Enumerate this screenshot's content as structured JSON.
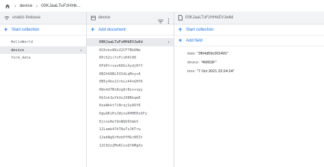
{
  "breadcrumb": {
    "items": [
      "device",
      "00KJaaLTuFzHHk..."
    ]
  },
  "panel1": {
    "title": "unabiz-firebase",
    "add_label": "Start collection",
    "collections": [
      "HelloWorld",
      "device",
      "form_data"
    ],
    "selected_index": 1
  },
  "panel2": {
    "title": "device",
    "add_label": "Add document",
    "documents": [
      "00KJaaLTuFzHHkEVJw6d",
      "0CKzko8KzZ2CF7Bb6Nm",
      "0Pc52irfcFcvH4t00",
      "0FdPtrsezK0GcXydjRfY",
      "0NZh68NL5XSdLqMzyvA",
      "0B5y4boJJrkLx44nGHY6",
      "0Wx4d7Bo8zg8rBzvvspy",
      "0b3xk3uYkVe2XBRkqmE",
      "0eaNkkt7iNrajSyA6Y0",
      "0gwQKiHxJWjeuRHHERzkFy",
      "0jcnoHefQnNQU93mbV",
      "12Lamk47kT8uTzJKTrw",
      "12abNg9rHzbPfMGrBEZt",
      "12C02o2MoKCoxQfAMgXo"
    ],
    "selected_index": 0
  },
  "panel3": {
    "title": "00KJaaLTuFzHHkEVJw6d",
    "start_collection_label": "Start collection",
    "add_field_label": "Add field",
    "fields": [
      {
        "key": "date:",
        "value": "\"3f04d59c001401\""
      },
      {
        "key": "device:",
        "value": "\"46653F\""
      },
      {
        "key": "time:",
        "value": "\"7 Oct 2021 22:24:24\""
      }
    ]
  },
  "colors": {
    "accent": "#1a73e8",
    "selected_bg": "#e8eaed",
    "header_bg": "#f1f3f4",
    "border": "#dadce0"
  },
  "icons": [
    "home-icon",
    "wifi-icon",
    "collection-icon",
    "document-icon",
    "filter-icon",
    "more-vert-icon",
    "chevron-right-icon"
  ]
}
